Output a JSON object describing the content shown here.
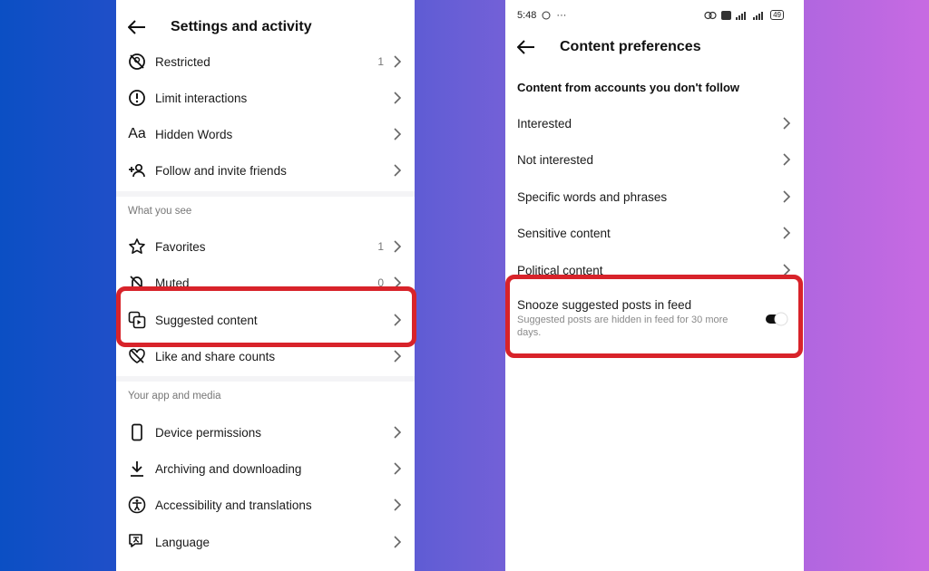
{
  "left": {
    "title": "Settings and activity",
    "rows_top": [
      {
        "label": "Restricted",
        "count": "1",
        "icon": "restricted-icon"
      },
      {
        "label": "Limit interactions",
        "count": "",
        "icon": "limit-icon"
      },
      {
        "label": "Hidden Words",
        "count": "",
        "icon": "hidden-words-icon"
      },
      {
        "label": "Follow and invite friends",
        "count": "",
        "icon": "add-person-icon"
      }
    ],
    "section_see": "What you see",
    "rows_see": [
      {
        "label": "Favorites",
        "count": "1",
        "icon": "star-icon"
      },
      {
        "label": "Muted",
        "count": "0",
        "icon": "muted-icon"
      },
      {
        "label": "Suggested content",
        "count": "",
        "icon": "suggested-content-icon"
      },
      {
        "label": "Like and share counts",
        "count": "",
        "icon": "heart-off-icon"
      }
    ],
    "section_app": "Your app and media",
    "rows_app": [
      {
        "label": "Device permissions",
        "icon": "phone-icon"
      },
      {
        "label": "Archiving and downloading",
        "icon": "download-icon"
      },
      {
        "label": "Accessibility and translations",
        "icon": "accessibility-icon"
      },
      {
        "label": "Language",
        "icon": "language-icon"
      }
    ]
  },
  "right": {
    "status_time": "5:48",
    "battery": "49",
    "title": "Content preferences",
    "section": "Content from accounts you don't follow",
    "rows": [
      {
        "label": "Interested"
      },
      {
        "label": "Not interested"
      },
      {
        "label": "Specific words and phrases"
      },
      {
        "label": "Sensitive content"
      },
      {
        "label": "Political content"
      }
    ],
    "snooze": {
      "title": "Snooze suggested posts in feed",
      "desc": "Suggested posts are hidden in feed for 30 more days.",
      "enabled": true
    }
  },
  "colors": {
    "highlight": "#d8232a",
    "gradient_start": "#0b4fc4",
    "gradient_end": "#c76ae2"
  }
}
